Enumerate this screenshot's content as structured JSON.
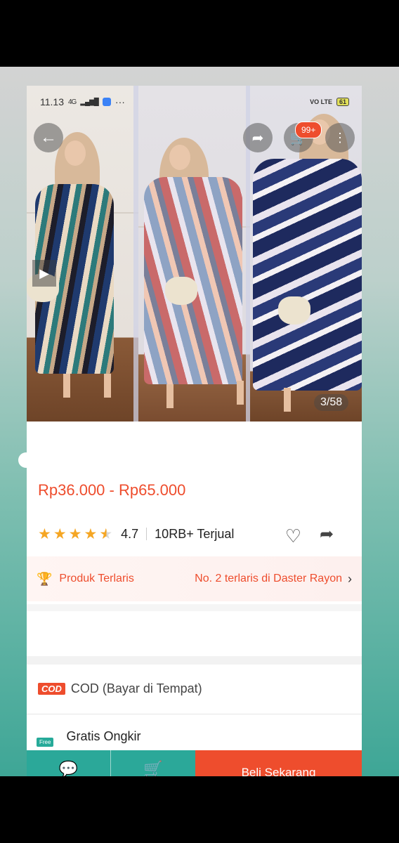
{
  "status_bar": {
    "time": "11.13",
    "network": "4G",
    "signal": "▂▄▆█",
    "dots": "···",
    "volte": "VO LTE",
    "battery": "61"
  },
  "header": {
    "cart_badge": "99+",
    "image_counter": "3/58"
  },
  "product": {
    "price_range": "Rp36.000 - Rp65.000",
    "rating": "4.7",
    "sold": "10RB+ Terjual",
    "bestseller_label": "Produk Terlaris",
    "bestseller_rank": "No. 2 terlaris di Daster Rayon"
  },
  "shipping": {
    "cod_badge": "COD",
    "cod_text": "COD (Bayar di Tempat)",
    "free_badge": "Free",
    "free_text": "Gratis Ongkir"
  },
  "bottom_bar": {
    "buy_now": "Beli Sekarang"
  },
  "colors": {
    "accent": "#ee4d2d",
    "teal": "#2ba899",
    "star": "#f5a623"
  }
}
